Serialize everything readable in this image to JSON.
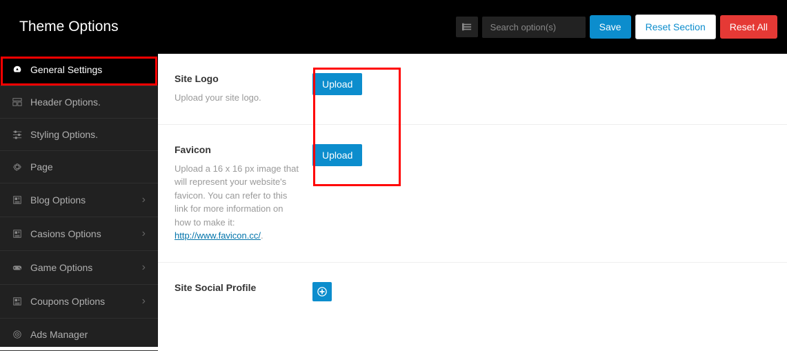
{
  "header": {
    "title": "Theme Options",
    "search_placeholder": "Search option(s)",
    "save": "Save",
    "reset_section": "Reset Section",
    "reset_all": "Reset All"
  },
  "sidebar": {
    "items": [
      {
        "label": "General Settings",
        "icon": "dashboard",
        "active": true,
        "expandable": false
      },
      {
        "label": "Header Options.",
        "icon": "layout",
        "active": false,
        "expandable": false
      },
      {
        "label": "Styling Options.",
        "icon": "sliders",
        "active": false,
        "expandable": false
      },
      {
        "label": "Page",
        "icon": "gears",
        "active": false,
        "expandable": false
      },
      {
        "label": "Blog Options",
        "icon": "news",
        "active": false,
        "expandable": true
      },
      {
        "label": "Casions Options",
        "icon": "news",
        "active": false,
        "expandable": true
      },
      {
        "label": "Game Options",
        "icon": "gamepad",
        "active": false,
        "expandable": true
      },
      {
        "label": "Coupons Options",
        "icon": "news",
        "active": false,
        "expandable": true
      },
      {
        "label": "Ads Manager",
        "icon": "bullseye",
        "active": false,
        "expandable": false
      }
    ]
  },
  "options": {
    "site_logo": {
      "title": "Site Logo",
      "desc": "Upload your site logo.",
      "button": "Upload"
    },
    "favicon": {
      "title": "Favicon",
      "desc_pre": "Upload a 16 x 16 px image that will represent your website's favicon. You can refer to this link for more information on how to make it: ",
      "link_text": "http://www.favicon.cc/",
      "desc_post": ".",
      "button": "Upload"
    },
    "social": {
      "title": "Site Social Profile"
    }
  }
}
